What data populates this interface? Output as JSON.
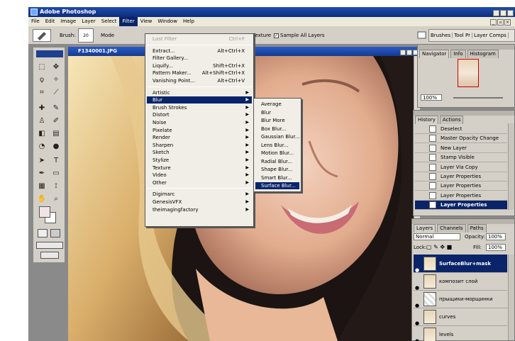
{
  "app": {
    "title": "Adobe Photoshop"
  },
  "menubar": [
    "File",
    "Edit",
    "Image",
    "Layer",
    "Select",
    "Filter",
    "View",
    "Window",
    "Help"
  ],
  "options": {
    "brush_label": "Brush:",
    "brush_size": "20",
    "mode_label": "Mode",
    "create_texture": "Create Texture",
    "sample_all_layers": "Sample All Layers"
  },
  "palette_well": [
    "Brushes",
    "Tool Pr",
    "Layer Comps"
  ],
  "document": {
    "title": "F1340001.JPG"
  },
  "filter_menu": [
    {
      "label": "Last Filter",
      "shortcut": "Ctrl+F",
      "disabled": true
    },
    {
      "sep": true
    },
    {
      "label": "Extract...",
      "shortcut": "Alt+Ctrl+X"
    },
    {
      "label": "Filter Gallery..."
    },
    {
      "label": "Liquify...",
      "shortcut": "Shift+Ctrl+X"
    },
    {
      "label": "Pattern Maker...",
      "shortcut": "Alt+Shift+Ctrl+X"
    },
    {
      "label": "Vanishing Point...",
      "shortcut": "Alt+Ctrl+V"
    },
    {
      "sep": true
    },
    {
      "label": "Artistic",
      "sub": true
    },
    {
      "label": "Blur",
      "sub": true,
      "hl": true
    },
    {
      "label": "Brush Strokes",
      "sub": true
    },
    {
      "label": "Distort",
      "sub": true
    },
    {
      "label": "Noise",
      "sub": true
    },
    {
      "label": "Pixelate",
      "sub": true
    },
    {
      "label": "Render",
      "sub": true
    },
    {
      "label": "Sharpen",
      "sub": true
    },
    {
      "label": "Sketch",
      "sub": true
    },
    {
      "label": "Stylize",
      "sub": true
    },
    {
      "label": "Texture",
      "sub": true
    },
    {
      "label": "Video",
      "sub": true
    },
    {
      "label": "Other",
      "sub": true
    },
    {
      "sep": true
    },
    {
      "label": "Digimarc",
      "sub": true
    },
    {
      "label": "GenesisVFX",
      "sub": true
    },
    {
      "label": "theimagingfactory",
      "sub": true
    }
  ],
  "blur_menu": [
    "Average",
    "Blur",
    "Blur More",
    "Box Blur...",
    "Gaussian Blur...",
    "Lens Blur...",
    "Motion Blur...",
    "Radial Blur...",
    "Shape Blur...",
    "Smart Blur...",
    "Surface Blur..."
  ],
  "blur_highlighted": 10,
  "navigator": {
    "tabs": [
      "Navigator",
      "Info",
      "Histogram"
    ],
    "zoom": "100%"
  },
  "history": {
    "tabs": [
      "History",
      "Actions"
    ],
    "items": [
      "Deselect",
      "Master Opacity Change",
      "New Layer",
      "Stamp Visible",
      "Layer Via Copy",
      "Layer Properties",
      "Layer Properties",
      "Layer Properties",
      "Layer Properties"
    ],
    "selected": 8
  },
  "layers": {
    "tabs": [
      "Layers",
      "Channels",
      "Paths"
    ],
    "blend_mode": "Normal",
    "opacity_label": "Opacity:",
    "opacity": "100%",
    "lock_label": "Lock:",
    "fill_label": "Fill:",
    "fill": "100%",
    "items": [
      "SurfaceBlur+mask",
      "композит слой",
      "прыщики-морщинки",
      "curves",
      "levels"
    ],
    "selected": 0
  }
}
